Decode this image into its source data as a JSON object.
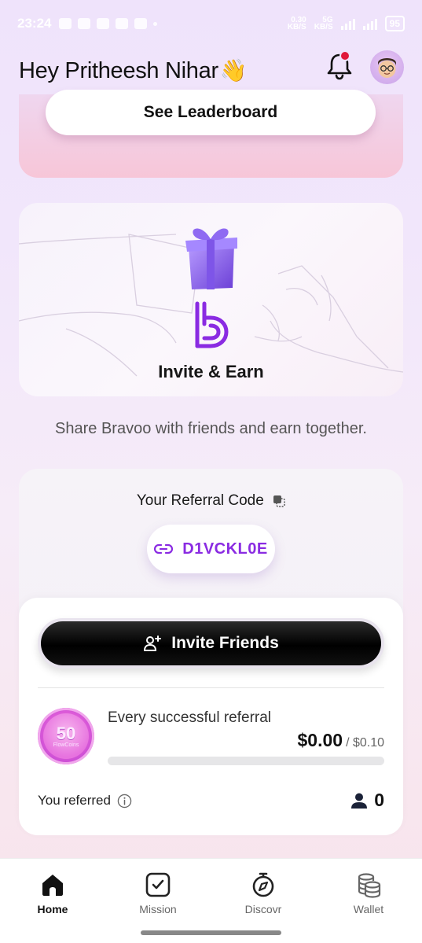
{
  "status_bar": {
    "time": "23:24",
    "net_speed_top": "0.30",
    "net_speed_unit": "KB/S",
    "net_speed_bottom": "KB/S",
    "network": "5G",
    "battery": "95"
  },
  "header": {
    "greeting": "Hey Pritheesh Nihar",
    "wave_emoji": "👋"
  },
  "leaderboard": {
    "button_label": "See Leaderboard"
  },
  "invite_card": {
    "title": "Invite & Earn"
  },
  "share_text": "Share Bravoo with friends and earn together.",
  "referral": {
    "title": "Your Referral Code",
    "code": "D1VCKL0E",
    "invite_button_label": "Invite Friends",
    "coin_value": "50",
    "coin_label": "FlowCoins",
    "description": "Every successful referral",
    "earned": "$0.00",
    "target": "/ $0.10",
    "progress_fraction": 0,
    "referred_label": "You referred",
    "referred_count": "0"
  },
  "nav": {
    "items": [
      {
        "label": "Home",
        "icon": "home-icon",
        "active": true
      },
      {
        "label": "Mission",
        "icon": "mission-icon",
        "active": false
      },
      {
        "label": "Discovr",
        "icon": "discover-icon",
        "active": false
      },
      {
        "label": "Wallet",
        "icon": "wallet-icon",
        "active": false
      }
    ]
  },
  "colors": {
    "accent": "#8a2be2",
    "notification_dot": "#e0193a"
  }
}
